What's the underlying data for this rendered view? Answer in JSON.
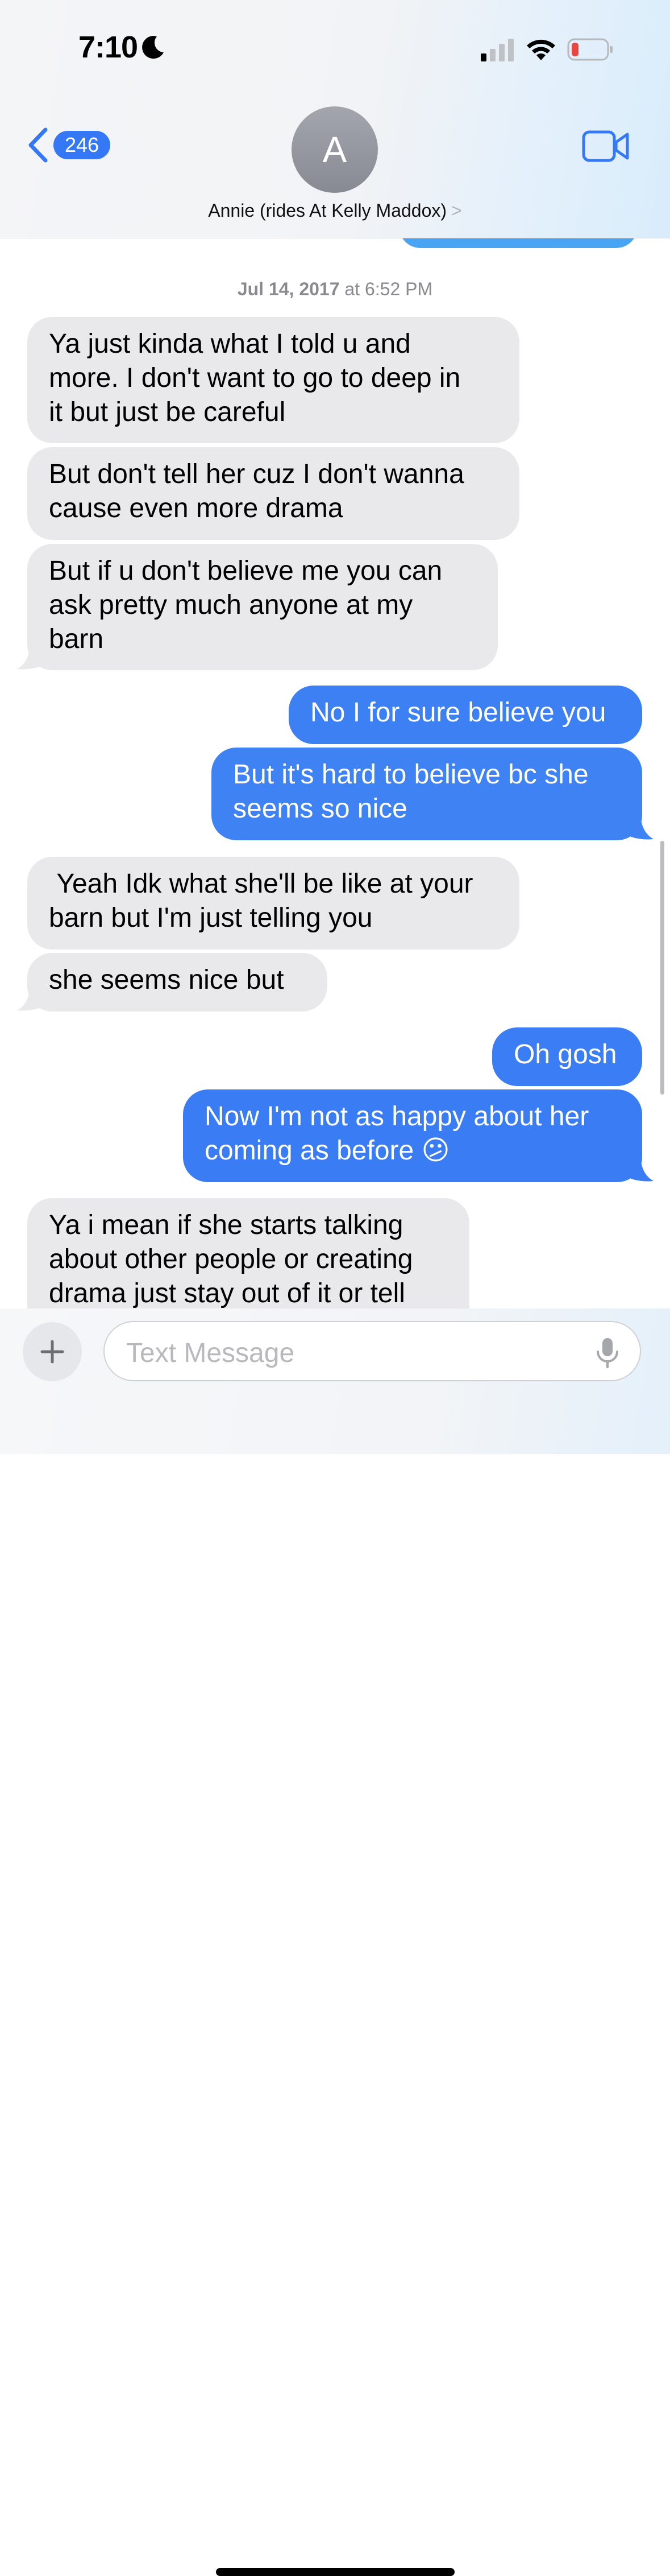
{
  "status_bar": {
    "time": "7:10",
    "focus_icon": "moon-icon",
    "signal_icon": "cellular-signal-icon",
    "wifi_icon": "wifi-icon",
    "battery_icon": "battery-low-icon",
    "battery_low_color": "#e8463f"
  },
  "nav": {
    "back_count": "246",
    "back_icon": "chevron-left-icon",
    "avatar_initial": "A",
    "contact_name": "Annie (rides At Kelly Maddox)",
    "contact_chevron": ">",
    "video_icon": "video-camera-icon"
  },
  "thread": {
    "timestamp_date": "Jul 14, 2017",
    "timestamp_time": " at 6:52 PM",
    "messages": [
      {
        "from": "them",
        "text": "Ya just kinda what I told u and\nmore. I don't want to go to deep in\nit but just be careful"
      },
      {
        "from": "them",
        "text": "But don't tell her cuz I don't wanna\ncause even more drama"
      },
      {
        "from": "them",
        "text": "But if u don't believe me you can\nask pretty much anyone at my\nbarn"
      },
      {
        "from": "me",
        "text": "No I for sure believe you"
      },
      {
        "from": "me",
        "text": "But it's hard to believe bc she\nseems so nice"
      },
      {
        "from": "them",
        "text": " Yeah Idk what she'll be like at your\nbarn but I'm just telling you"
      },
      {
        "from": "them",
        "text": "she seems nice but"
      },
      {
        "from": "me",
        "text": "Oh gosh"
      },
      {
        "from": "me",
        "text": "Now I'm not as happy about her\ncoming as before 😕"
      },
      {
        "from": "them",
        "text": "Ya i mean if she starts talking\nabout other people or creating\ndrama just stay out of it or tell"
      }
    ]
  },
  "composer": {
    "placeholder": "Text Message",
    "value": "",
    "plus_icon": "plus-icon",
    "mic_icon": "microphone-icon"
  },
  "colors": {
    "sent_bubble": "#3478f6",
    "received_bubble": "#e9e9eb",
    "accent": "#3478f6"
  }
}
